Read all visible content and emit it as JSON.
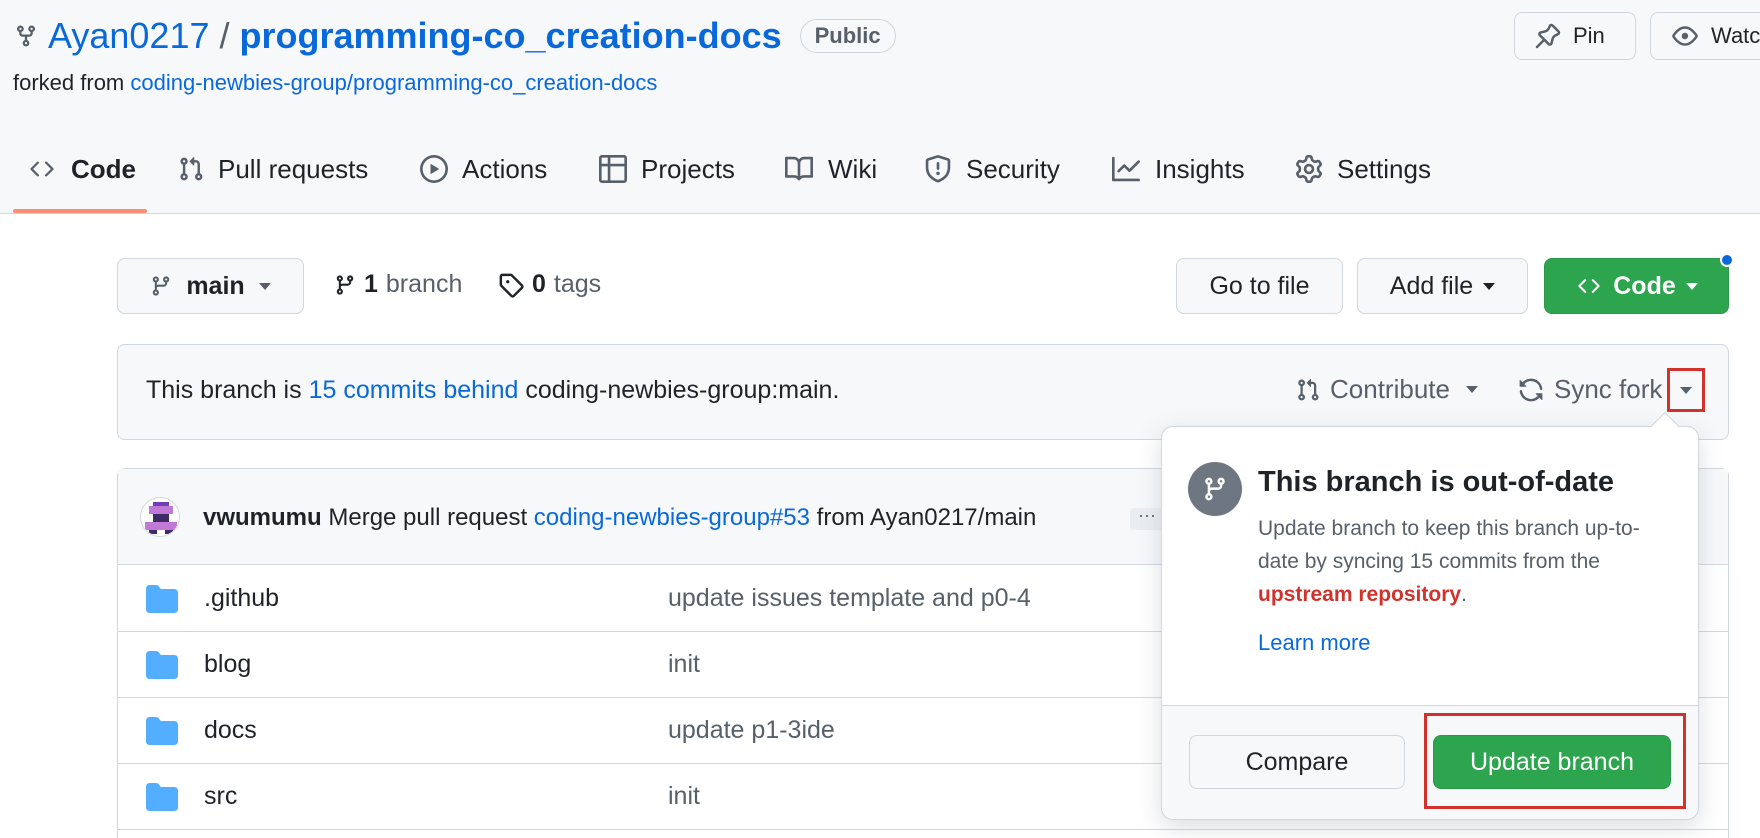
{
  "repo": {
    "owner": "Ayan0217",
    "slash": "/",
    "name": "programming-co_creation-docs",
    "visibility": "Public",
    "forked_prefix": "forked from ",
    "forked_source": "coding-newbies-group/programming-co_creation-docs"
  },
  "header_actions": {
    "pin": "Pin",
    "watch": "Watc"
  },
  "tabs": [
    {
      "label": "Code",
      "icon": "code-icon",
      "active": true
    },
    {
      "label": "Pull requests",
      "icon": "pull-request-icon"
    },
    {
      "label": "Actions",
      "icon": "play-icon"
    },
    {
      "label": "Projects",
      "icon": "table-icon"
    },
    {
      "label": "Wiki",
      "icon": "book-icon"
    },
    {
      "label": "Security",
      "icon": "shield-icon"
    },
    {
      "label": "Insights",
      "icon": "graph-icon"
    },
    {
      "label": "Settings",
      "icon": "gear-icon"
    }
  ],
  "branch_bar": {
    "branch": "main",
    "branch_count": "1",
    "branch_word": "branch",
    "tag_count": "0",
    "tag_word": "tags",
    "go_to_file": "Go to file",
    "add_file": "Add file",
    "code": "Code"
  },
  "fork_banner": {
    "prefix": "This branch is ",
    "link": "15 commits behind",
    "suffix": " coding-newbies-group:main.",
    "contribute": "Contribute",
    "sync_fork": "Sync fork"
  },
  "latest_commit": {
    "author": "vwumumu",
    "message_prefix": " Merge pull request ",
    "pr_link": "coding-newbies-group#53",
    "message_suffix": " from Ayan0217/main",
    "more": "···"
  },
  "files": [
    {
      "name": ".github",
      "message": "update issues template and p0-4"
    },
    {
      "name": "blog",
      "message": "init"
    },
    {
      "name": "docs",
      "message": "update p1-3ide"
    },
    {
      "name": "src",
      "message": "init"
    }
  ],
  "popover": {
    "title": "This branch is out-of-date",
    "desc": "Update branch to keep this branch up-to-date by syncing 15 commits from the ",
    "desc_link": "upstream repository",
    "desc_end": ".",
    "learn_more": "Learn more",
    "compare": "Compare",
    "update_branch": "Update branch"
  },
  "colors": {
    "link": "#0969da",
    "green": "#2da44e",
    "highlight": "#d1332c",
    "tab_underline": "#fd8c73"
  }
}
